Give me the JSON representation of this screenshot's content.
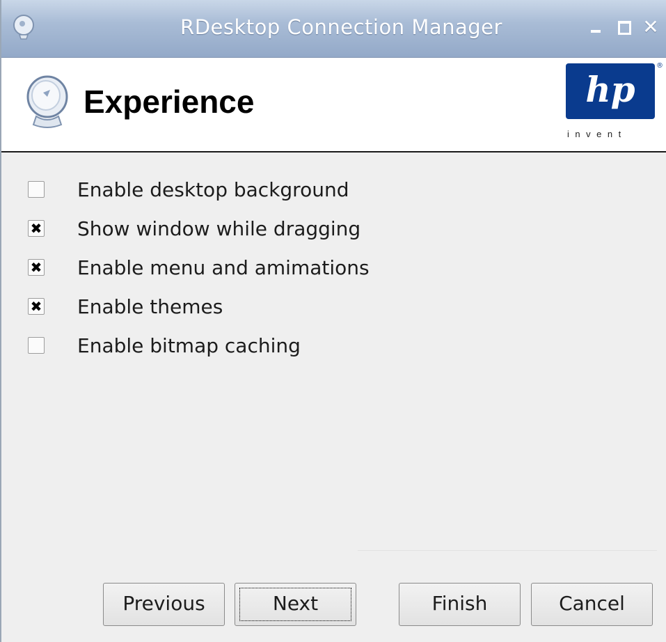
{
  "window": {
    "title": "RDesktop Connection Manager",
    "controls": {
      "minimize_icon": "minimize-icon",
      "maximize_icon": "maximize-icon",
      "close_icon": "close-icon"
    }
  },
  "header": {
    "title": "Experience",
    "logo": {
      "mark": "hp",
      "tagline": "invent",
      "brand_color": "#0a3b8e"
    }
  },
  "options": [
    {
      "label": "Enable desktop background",
      "checked": false
    },
    {
      "label": "Show window while dragging",
      "checked": true
    },
    {
      "label": "Enable menu and amimations",
      "checked": true
    },
    {
      "label": "Enable themes",
      "checked": true
    },
    {
      "label": "Enable bitmap caching",
      "checked": false
    }
  ],
  "buttons": {
    "previous": "Previous",
    "next": "Next",
    "finish": "Finish",
    "cancel": "Cancel"
  }
}
